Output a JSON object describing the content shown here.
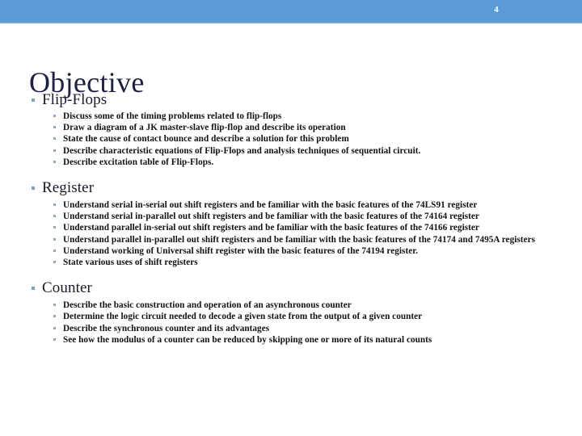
{
  "header": {
    "page_number": "4",
    "bar_color": "#5b9bd5"
  },
  "title": "Objective",
  "title_color": "#1f2045",
  "sections": [
    {
      "heading": "Flip-Flops",
      "items": [
        "Discuss some of the timing problems related to flip-flops",
        "Draw a diagram of a JK master-slave flip-flop and describe its operation",
        "State the cause of contact bounce and describe a solution for this problem",
        "Describe characteristic equations of Flip-Flops and analysis techniques of sequential circuit.",
        "Describe excitation table of Flip-Flops."
      ]
    },
    {
      "heading": "Register",
      "items": [
        "Understand serial in-serial out shift registers and be familiar with the basic features of the 74LS91 register",
        "Understand serial in-parallel out shift registers and be familiar with the basic features of the 74164 register",
        "Understand parallel in-serial out shift registers and be familiar with the basic features of the 74166 register",
        "Understand parallel in-parallel out shift registers and be familiar with the basic features of the 74174 and 7495A registers",
        "Understand working of Universal shift register with the basic features of the 74194 register.",
        "State various uses of shift registers"
      ]
    },
    {
      "heading": "Counter",
      "items": [
        "Describe the basic construction and operation of an asynchronous counter",
        "Determine the logic circuit needed to decode a given state from the output of a given counter",
        "Describe the synchronous counter and its advantages",
        "See how the modulus of a counter can be reduced by skipping one or more of its natural counts"
      ]
    }
  ]
}
